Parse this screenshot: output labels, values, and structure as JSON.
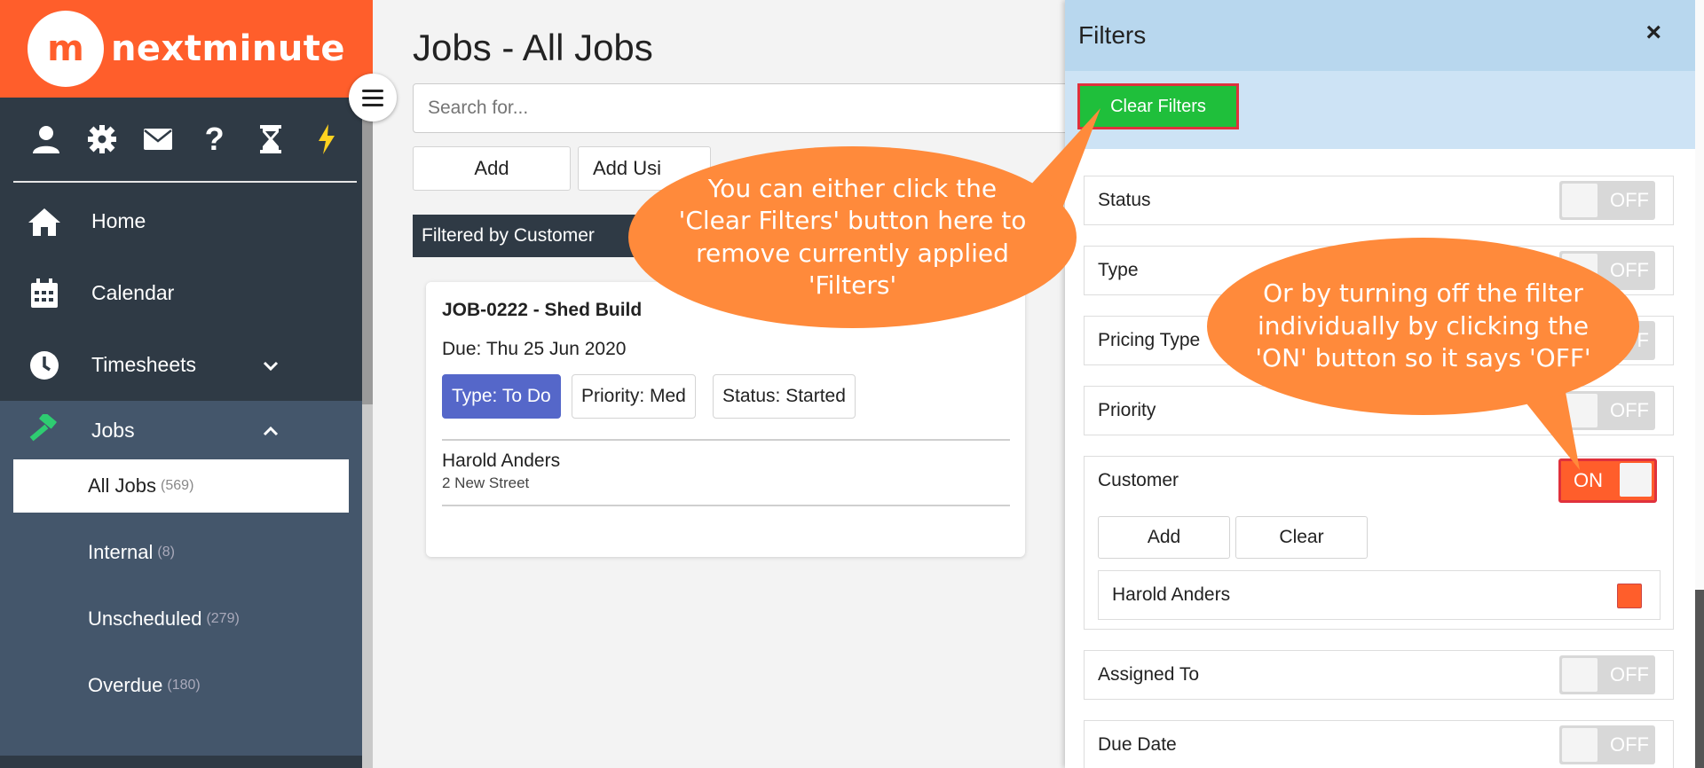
{
  "brand": {
    "logo_mark": "m",
    "name": "nextminute"
  },
  "toolbar_icons": [
    "user-icon",
    "gear-icon",
    "envelope-icon",
    "question-icon",
    "hourglass-icon",
    "bolt-icon"
  ],
  "nav": {
    "home": "Home",
    "calendar": "Calendar",
    "timesheets": "Timesheets",
    "jobs": "Jobs",
    "sub_items": [
      {
        "label": "All Jobs",
        "count": "(569)"
      },
      {
        "label": "Internal",
        "count": "(8)"
      },
      {
        "label": "Unscheduled",
        "count": "(279)"
      },
      {
        "label": "Overdue",
        "count": "(180)"
      }
    ]
  },
  "main": {
    "title": "Jobs - All Jobs",
    "search_placeholder": "Search for...",
    "add_label": "Add",
    "add_using_label": "Add Usi",
    "filter_banner": "Filtered by Customer",
    "job": {
      "title": "JOB-0222 - Shed Build",
      "due": "Due: Thu 25 Jun 2020",
      "tags": [
        "Type: To Do",
        "Priority: Med",
        "Status: Started"
      ],
      "customer_name": "Harold Anders",
      "customer_address": "2 New Street"
    }
  },
  "filters": {
    "title": "Filters",
    "close": "×",
    "clear_label": "Clear Filters",
    "rows": [
      {
        "label": "Status",
        "state": "OFF"
      },
      {
        "label": "Type",
        "state": "OFF"
      },
      {
        "label": "Pricing Type",
        "state": "OFF"
      },
      {
        "label": "Priority",
        "state": "OFF"
      },
      {
        "label": "Customer",
        "state": "ON"
      },
      {
        "label": "Assigned To",
        "state": "OFF"
      },
      {
        "label": "Due Date",
        "state": "OFF"
      }
    ],
    "customer_add": "Add",
    "customer_clear": "Clear",
    "customer_selected": "Harold Anders"
  },
  "callouts": {
    "first": "You can either click the 'Clear Filters' button here to remove currently applied 'Filters'",
    "second": "Or by turning off the filter individually by clicking the 'ON' button so it says 'OFF'"
  },
  "colors": {
    "brand_orange": "#ff5e2b",
    "callout": "#ff8a3b",
    "clear_green": "#1fbf3b",
    "highlight_red": "#e0313c",
    "tag_blue": "#5567c9"
  }
}
